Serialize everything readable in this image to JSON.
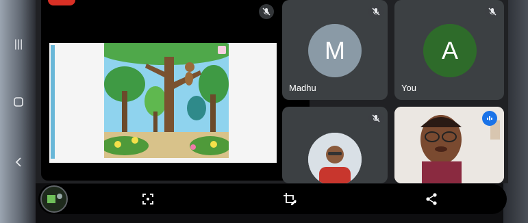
{
  "tiles": {
    "p1": {
      "name": "Madhu",
      "initial": "M",
      "color": "#8a9aa6"
    },
    "p2": {
      "name": "You",
      "initial": "A",
      "color": "#2e6b2a"
    }
  },
  "toolbar": {
    "icons": [
      "fullscreen-icon",
      "crop-edit-icon",
      "share-icon"
    ]
  },
  "colors": {
    "tile": "#3c4043",
    "background": "#202124"
  }
}
